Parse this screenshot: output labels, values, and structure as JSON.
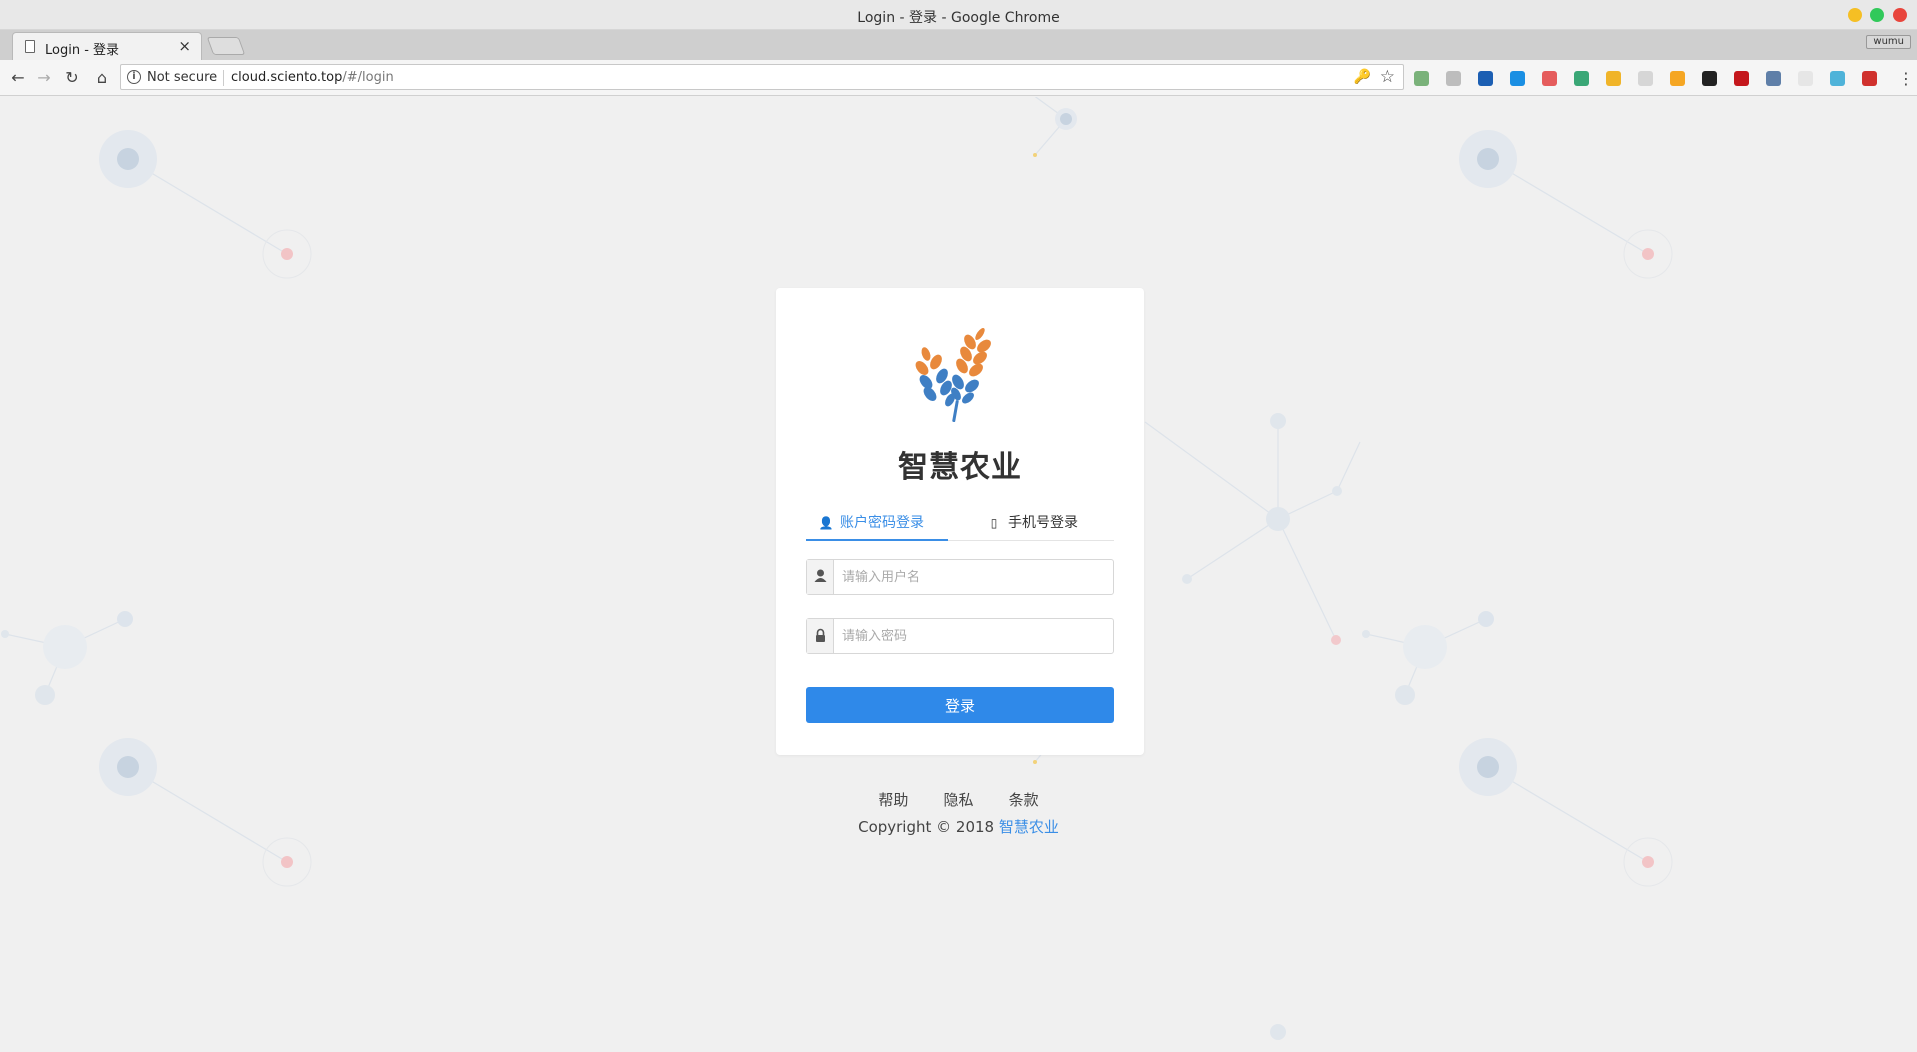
{
  "window": {
    "title": "Login - 登录 - Google Chrome"
  },
  "tab": {
    "title": "Login - 登录",
    "close_glyph": "×",
    "profile_label": "wumu"
  },
  "toolbar": {
    "security_label": "Not secure",
    "url_host": "cloud.sciento.top",
    "url_path": "/#/login",
    "menu_glyph": "⋮"
  },
  "extensions": [
    {
      "name": "green-dot-extension-icon",
      "color": "#7ab27a"
    },
    {
      "name": "image-extension-icon",
      "color": "#bdbdbd"
    },
    {
      "name": "v-extension-icon",
      "color": "#1c5fb3"
    },
    {
      "name": "d-extension-icon",
      "color": "#1a8fe3"
    },
    {
      "name": "red-circle-extension-icon",
      "color": "#e55c5c"
    },
    {
      "name": "vue-extension-icon",
      "color": "#3aa776"
    },
    {
      "name": "chrome-colorful-extension-icon",
      "color": "#f0b429"
    },
    {
      "name": "grid-extension-icon",
      "color": "#d6d6d6"
    },
    {
      "name": "orange-square-extension-icon",
      "color": "#f5a623"
    },
    {
      "name": "bird-extension-icon",
      "color": "#222222"
    },
    {
      "name": "adblock-extension-icon",
      "color": "#c4171c"
    },
    {
      "name": "globe-extension-icon",
      "color": "#5f7fa8"
    },
    {
      "name": "pale-circle-extension-icon",
      "color": "#e6e6e6"
    },
    {
      "name": "react-extension-icon",
      "color": "#4fb3d9"
    },
    {
      "name": "pdf-extension-icon",
      "color": "#d0312d"
    }
  ],
  "login": {
    "brand": "智慧农业",
    "tab_account": "账户密码登录",
    "tab_phone": "手机号登录",
    "username_placeholder": "请输入用户名",
    "password_placeholder": "请输入密码",
    "submit_label": "登录"
  },
  "footer": {
    "links": [
      "帮助",
      "隐私",
      "条款"
    ],
    "copyright": "Copyright © 2018",
    "brand": "智慧农业"
  },
  "colors": {
    "accent": "#2f89e9",
    "logo_orange": "#e8893c",
    "logo_blue": "#3f7fc4"
  }
}
